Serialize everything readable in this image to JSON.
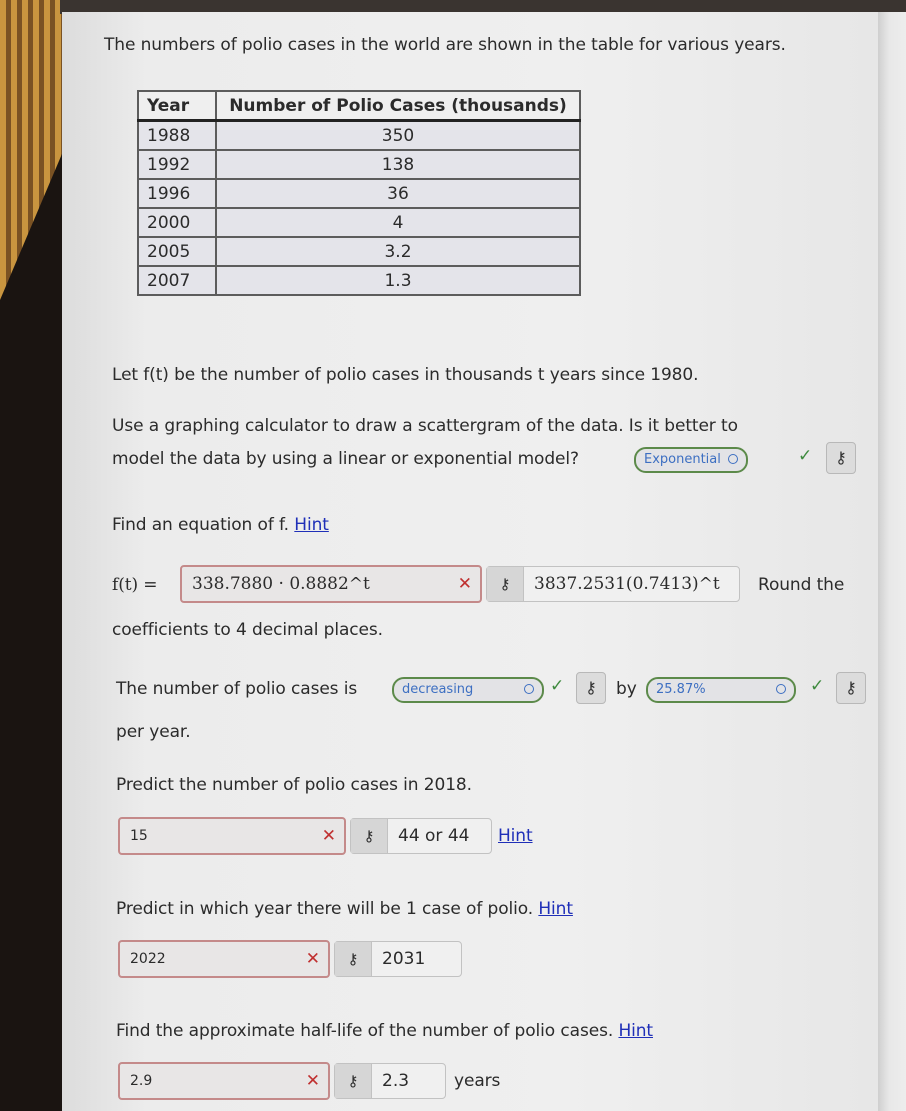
{
  "intro": "The numbers of polio cases in the world are shown in the table for various years.",
  "table": {
    "headers": [
      "Year",
      "Number of Polio Cases (thousands)"
    ],
    "rows": [
      [
        "1988",
        "350"
      ],
      [
        "1992",
        "138"
      ],
      [
        "1996",
        "36"
      ],
      [
        "2000",
        "4"
      ],
      [
        "2005",
        "3.2"
      ],
      [
        "2007",
        "1.3"
      ]
    ]
  },
  "definition": "Let f(t) be the number of polio cases in thousands t years since 1980.",
  "q1": {
    "line1": "Use a graphing calculator to draw a scattergram of the data. Is it better to",
    "line2": "model the data by using a linear or exponential model?",
    "selected": "Exponential",
    "status": "correct"
  },
  "q2": {
    "prompt": "Find an equation of f.",
    "hint": "Hint",
    "lhs": "f(t) =",
    "input_value": "338.7880 · 0.8882^t",
    "answer": "3837.2531(0.7413)^t",
    "after": "Round the",
    "line2": "coefficients to 4 decimal places.",
    "status": "incorrect"
  },
  "q3": {
    "prefix": "The number of polio cases is",
    "selected_trend": "decreasing",
    "by": "by",
    "selected_rate": "25.87%",
    "suffix": "per year.",
    "status": "correct"
  },
  "q4": {
    "prompt": "Predict the number of polio cases in 2018.",
    "input_value": "15",
    "answer": "44 or 44",
    "hint": "Hint",
    "status": "incorrect"
  },
  "q5": {
    "prompt": "Predict in which year there will be 1 case of polio.",
    "hint": "Hint",
    "input_value": "2022",
    "answer": "2031",
    "status": "incorrect"
  },
  "q6": {
    "prompt": "Find the approximate half-life of the number of polio cases.",
    "hint": "Hint",
    "input_value": "2.9",
    "answer": "2.3",
    "unit": "years",
    "status": "incorrect"
  },
  "icons": {
    "check": "✓",
    "cross": "✕",
    "key": "⚷"
  },
  "colors": {
    "correct": "#3e8a3e",
    "incorrect": "#c03030",
    "link": "#1f2fb8",
    "select_text": "#3d6fc2"
  }
}
